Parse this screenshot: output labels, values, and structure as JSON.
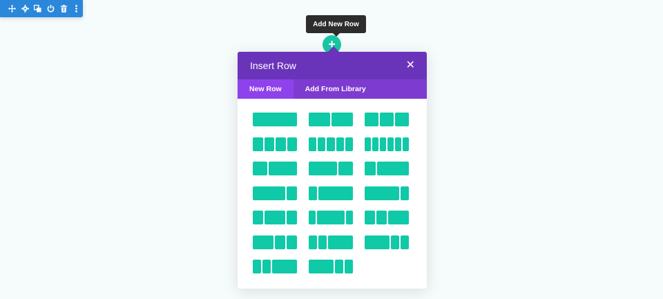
{
  "toolbar": {
    "icons": [
      "move-icon",
      "gear-icon",
      "duplicate-icon",
      "power-icon",
      "trash-icon",
      "more-icon"
    ],
    "color": "#2b87da"
  },
  "tooltip": {
    "text": "Add New Row"
  },
  "add_button": {
    "symbol": "+",
    "color": "#18c6a5"
  },
  "modal": {
    "title": "Insert Row",
    "close_symbol": "✕",
    "header_color": "#6a34ba",
    "tabs": [
      {
        "label": "New Row",
        "active": true
      },
      {
        "label": "Add From Library",
        "active": false
      }
    ]
  },
  "layouts": {
    "block_color": "#0fc9a7",
    "rows": [
      [
        [
          1
        ],
        [
          1,
          1
        ],
        [
          1,
          1,
          1
        ]
      ],
      [
        [
          1,
          1,
          1,
          1
        ],
        [
          1,
          1,
          1,
          1,
          1
        ],
        [
          1,
          1,
          1,
          1,
          1,
          1
        ]
      ],
      [
        [
          1,
          2
        ],
        [
          2,
          1
        ],
        [
          1,
          3
        ]
      ],
      [
        [
          3,
          1
        ],
        [
          1,
          4
        ],
        [
          4,
          1
        ]
      ],
      [
        [
          1,
          2,
          1
        ],
        [
          1,
          4,
          1
        ],
        [
          1,
          1,
          2
        ]
      ],
      [
        [
          2,
          1,
          1
        ],
        [
          1,
          1,
          3
        ],
        [
          3,
          1,
          1
        ]
      ],
      [
        [
          1,
          1,
          3
        ],
        [
          3,
          1,
          1
        ]
      ]
    ]
  }
}
